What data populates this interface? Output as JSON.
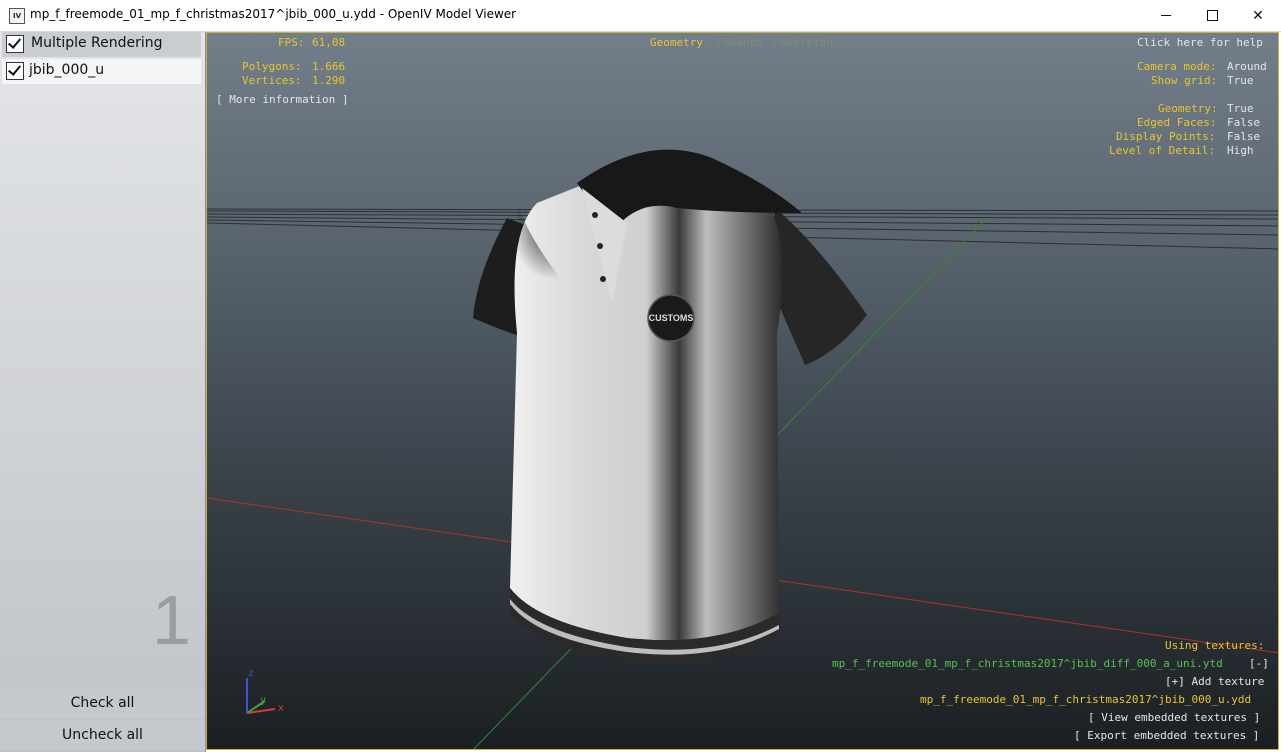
{
  "window": {
    "title": "mp_f_freemode_01_mp_f_christmas2017^jbib_000_u.ydd - OpenIV Model Viewer",
    "icon_text": "IV",
    "minimize_icon": "minimize-icon",
    "maximize_icon": "maximize-icon",
    "close_icon": "close-icon",
    "close_glyph": "✕"
  },
  "left_panel": {
    "multiple_rendering_label": "Multiple Rendering",
    "model_item_label": "jbib_000_u",
    "model_count": "1",
    "check_all_label": "Check all",
    "uncheck_all_label": "Uncheck all"
  },
  "viewport": {
    "fps_label": "FPS:",
    "fps_value": "61,08",
    "polygons_label": "Polygons:",
    "polygons_value": "1.666",
    "vertices_label": "Vertices:",
    "vertices_value": "1.290",
    "more_info": "[ More information ]",
    "tabs": [
      "Geometry",
      "Sounds",
      "Skeleton"
    ],
    "tab_separator": "|",
    "help": "Click here for help",
    "settings": {
      "camera_mode_label": "Camera mode:",
      "camera_mode_value": "Around",
      "show_grid_label": "Show grid:",
      "show_grid_value": "True",
      "geometry_label": "Geometry:",
      "geometry_value": "True",
      "edged_faces_label": "Edged Faces:",
      "edged_faces_value": "False",
      "display_points_label": "Display Points:",
      "display_points_value": "False",
      "lod_label": "Level of Detail:",
      "lod_value": "High"
    },
    "textures": {
      "header": "Using textures:",
      "texture_file": "mp_f_freemode_01_mp_f_christmas2017^jbib_diff_000_a_uni.ytd",
      "remove_button": "[-]",
      "add_texture": "[+] Add texture",
      "embedded_file": "mp_f_freemode_01_mp_f_christmas2017^jbib_000_u.ydd",
      "view_embedded": "[ View embedded textures ]",
      "export_embedded": "[ Export embedded textures ]"
    },
    "axis_labels": {
      "x": "x",
      "y": "y",
      "z": "z"
    },
    "logo_text": "CUSTOMS",
    "colors": {
      "hud_yellow": "#e8c72a",
      "hud_white": "#e6e6e6",
      "hud_green": "#56c24a",
      "axis_x": "#d93a3a",
      "axis_y": "#3aa63a",
      "axis_z": "#3a55d9"
    }
  }
}
